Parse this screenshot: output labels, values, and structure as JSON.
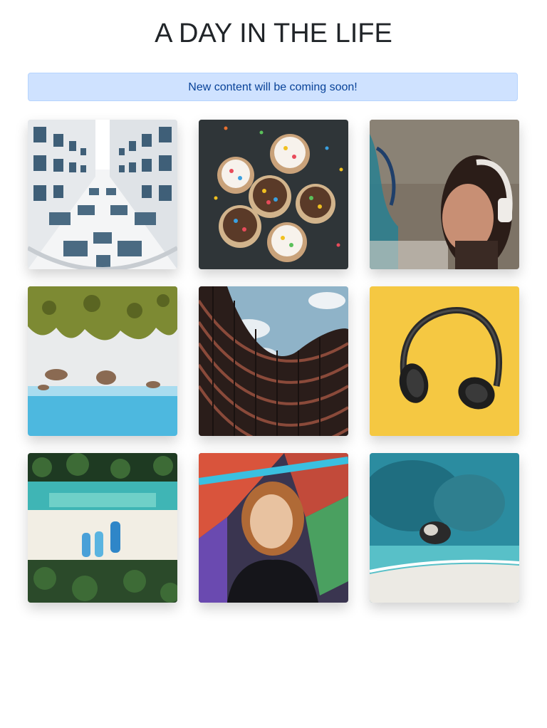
{
  "page": {
    "title": "A DAY IN THE LIFE"
  },
  "alert": {
    "text": "New content will be coming soon!",
    "colors": {
      "background": "#cfe2ff",
      "border": "#b6d4fe",
      "text": "#084298"
    }
  },
  "gallery": {
    "images": [
      {
        "name": "white-building-facade-photo"
      },
      {
        "name": "cupcakes-sprinkles-photo"
      },
      {
        "name": "girl-headphones-graffiti-photo"
      },
      {
        "name": "beach-palm-trees-aerial-photo"
      },
      {
        "name": "curved-building-sky-photo"
      },
      {
        "name": "headphones-yellow-background-photo"
      },
      {
        "name": "beach-boats-palms-aerial-photo"
      },
      {
        "name": "person-graffiti-wall-photo"
      },
      {
        "name": "turquoise-sea-rocks-aerial-photo"
      }
    ]
  }
}
